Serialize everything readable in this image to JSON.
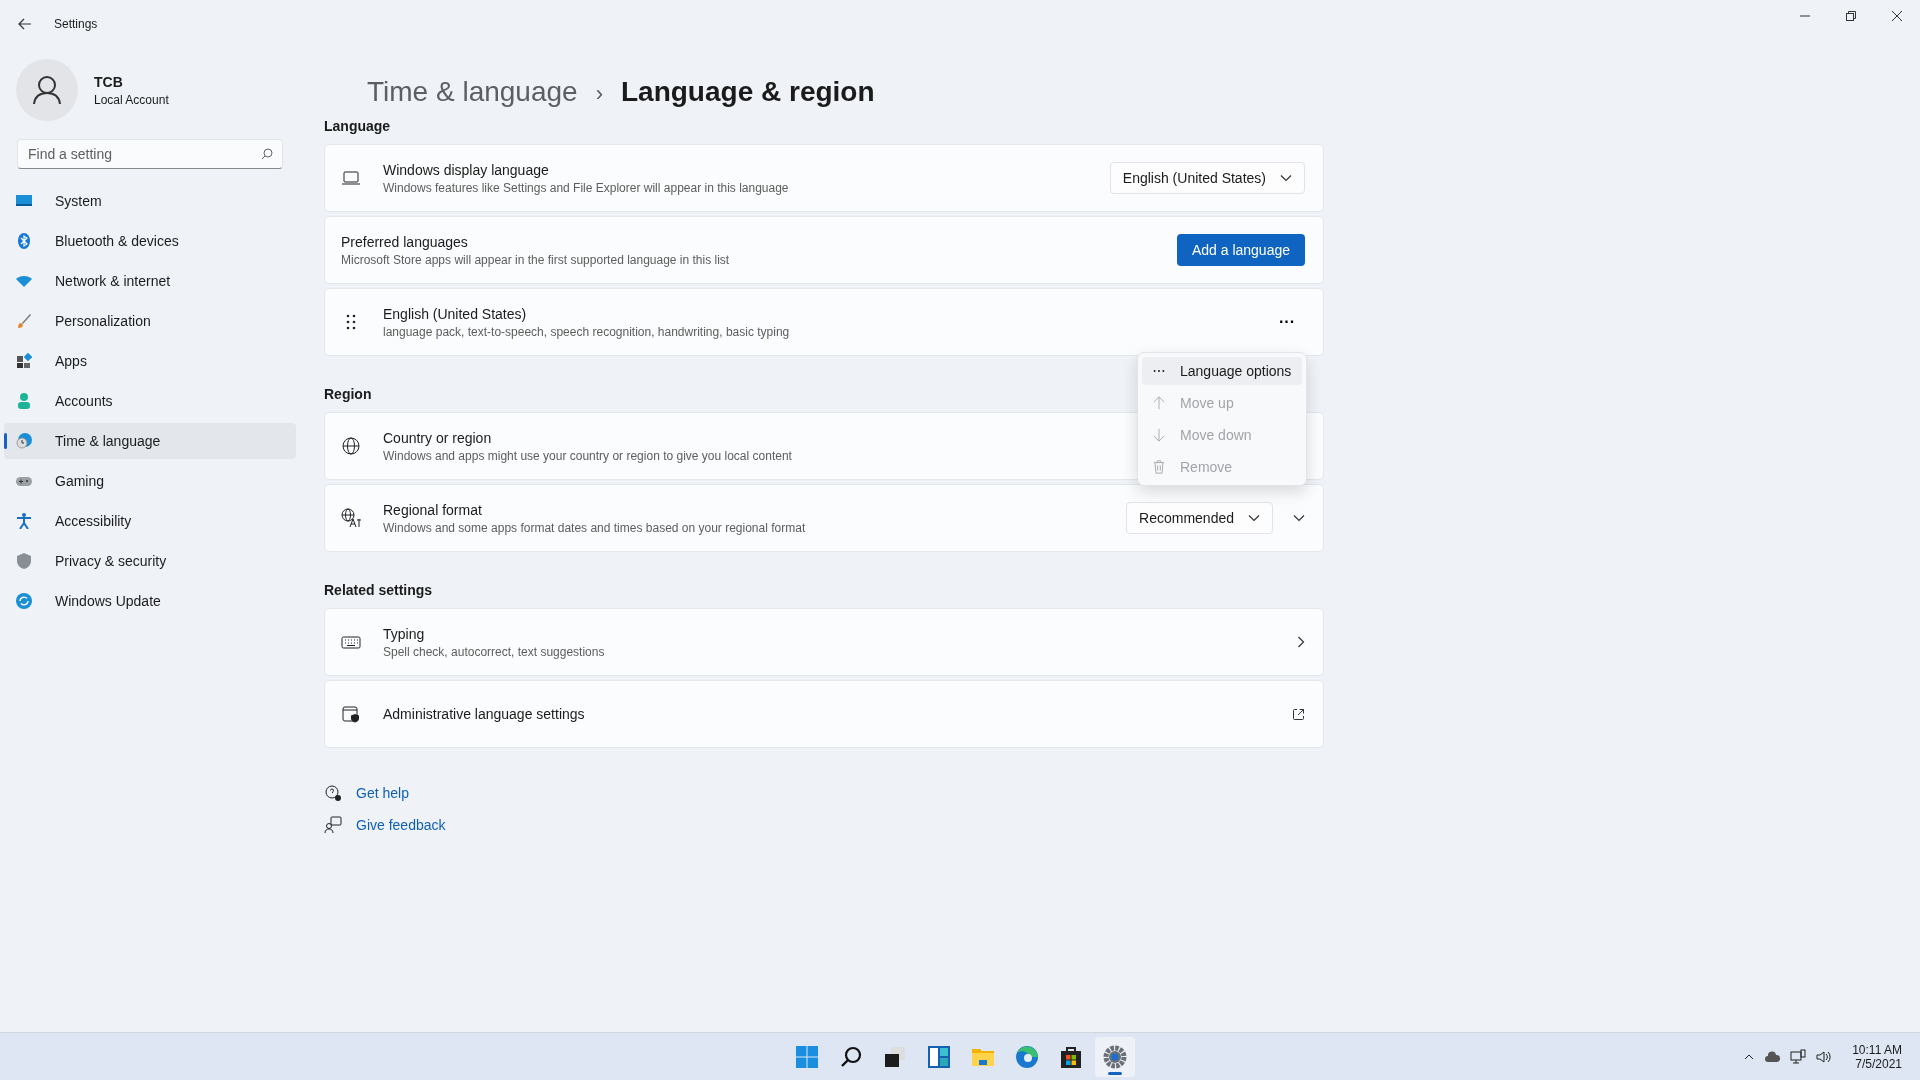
{
  "window": {
    "title": "Settings"
  },
  "account": {
    "name": "TCB",
    "type": "Local Account"
  },
  "search": {
    "placeholder": "Find a setting"
  },
  "sidebar": {
    "items": [
      {
        "label": "System",
        "kind": "system",
        "selected": false
      },
      {
        "label": "Bluetooth & devices",
        "kind": "bluetooth",
        "selected": false
      },
      {
        "label": "Network & internet",
        "kind": "network",
        "selected": false
      },
      {
        "label": "Personalization",
        "kind": "brush",
        "selected": false
      },
      {
        "label": "Apps",
        "kind": "apps",
        "selected": false
      },
      {
        "label": "Accounts",
        "kind": "accounts",
        "selected": false
      },
      {
        "label": "Time & language",
        "kind": "time",
        "selected": true
      },
      {
        "label": "Gaming",
        "kind": "gaming",
        "selected": false
      },
      {
        "label": "Accessibility",
        "kind": "accessibility",
        "selected": false
      },
      {
        "label": "Privacy & security",
        "kind": "privacy",
        "selected": false
      },
      {
        "label": "Windows Update",
        "kind": "update",
        "selected": false
      }
    ]
  },
  "breadcrumb": {
    "parent": "Time & language",
    "separator": "›",
    "current": "Language & region"
  },
  "sections": [
    {
      "title": "Language",
      "cards": [
        {
          "kind": "display",
          "title": "Windows display language",
          "subtitle": "Windows features like Settings and File Explorer will appear in this language",
          "control": {
            "kind": "dropdown",
            "label": "English (United States)"
          }
        },
        {
          "kind": "plain",
          "title": "Preferred languages",
          "subtitle": "Microsoft Store apps will appear in the first supported language in this list",
          "control": {
            "kind": "button",
            "label": "Add a language"
          }
        },
        {
          "kind": "drag",
          "title": "English (United States)",
          "subtitle": "language pack, text-to-speech, speech recognition, handwriting, basic typing",
          "control": {
            "kind": "more",
            "label": "···"
          }
        }
      ]
    },
    {
      "title": "Region",
      "cards": [
        {
          "kind": "globe",
          "title": "Country or region",
          "subtitle": "Windows and apps might use your country or region to give you local content",
          "control": {
            "kind": "hidden"
          }
        },
        {
          "kind": "format",
          "title": "Regional format",
          "subtitle": "Windows and some apps format dates and times based on your regional format",
          "control": {
            "kind": "dropdown-expand",
            "label": "Recommended"
          }
        }
      ]
    },
    {
      "title": "Related settings",
      "cards": [
        {
          "kind": "keyboard",
          "title": "Typing",
          "subtitle": "Spell check, autocorrect, text suggestions",
          "control": {
            "kind": "chevron"
          }
        },
        {
          "kind": "admin",
          "title": "Administrative language settings",
          "control": {
            "kind": "external"
          }
        }
      ]
    }
  ],
  "help_links": [
    {
      "kind": "help",
      "label": "Get help"
    },
    {
      "kind": "feedback",
      "label": "Give feedback"
    }
  ],
  "context_menu": {
    "items": [
      {
        "kind": "more",
        "label": "Language options",
        "selected": true,
        "disabled": false
      },
      {
        "kind": "up",
        "label": "Move up",
        "selected": false,
        "disabled": true
      },
      {
        "kind": "down",
        "label": "Move down",
        "selected": false,
        "disabled": true
      },
      {
        "kind": "delete",
        "label": "Remove",
        "selected": false,
        "disabled": true
      }
    ]
  },
  "taskbar": {
    "items": [
      {
        "kind": "start",
        "selected": false
      },
      {
        "kind": "search",
        "selected": false
      },
      {
        "kind": "taskview",
        "selected": false
      },
      {
        "kind": "widgets",
        "selected": false
      },
      {
        "kind": "explorer",
        "selected": false
      },
      {
        "kind": "edge",
        "selected": false
      },
      {
        "kind": "store",
        "selected": false
      },
      {
        "kind": "settings",
        "selected": true
      }
    ],
    "time": "10:11 AM",
    "date": "7/5/2021"
  }
}
